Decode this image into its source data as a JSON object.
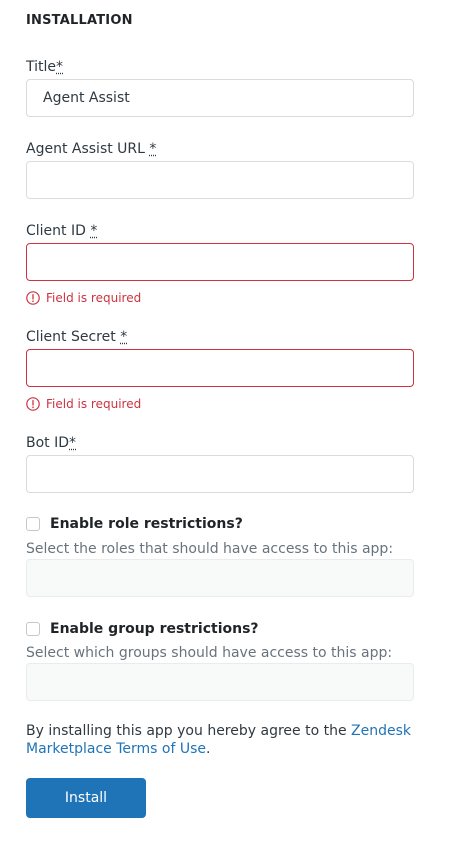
{
  "section": {
    "heading": "INSTALLATION"
  },
  "form": {
    "title": {
      "label": "Title",
      "required_mark": "*",
      "value": "Agent Assist",
      "placeholder": ""
    },
    "agent_assist_url": {
      "label": "Agent Assist URL ",
      "required_mark": "*",
      "value": "",
      "placeholder": ""
    },
    "client_id": {
      "label": "Client ID ",
      "required_mark": "*",
      "value": "",
      "placeholder": "",
      "error": "Field is required"
    },
    "client_secret": {
      "label": "Client Secret ",
      "required_mark": "*",
      "value": "",
      "placeholder": "",
      "error": "Field is required"
    },
    "bot_id": {
      "label": "Bot ID",
      "required_mark": "*",
      "value": "",
      "placeholder": ""
    }
  },
  "restrictions": {
    "role": {
      "label": "Enable role restrictions?",
      "hint": "Select the roles that should have access to this app:",
      "checked": false
    },
    "group": {
      "label": "Enable group restrictions?",
      "hint": "Select which groups should have access to this app:",
      "checked": false
    }
  },
  "terms": {
    "prefix": "By installing this app you hereby agree to the ",
    "link_text": "Zendesk Marketplace Terms of Use",
    "suffix": "."
  },
  "actions": {
    "install_label": "Install"
  },
  "colors": {
    "primary": "#1f73b7",
    "error": "#cc3340",
    "border": "#d8dcde",
    "disabled_bg": "#f8f9f9"
  },
  "icons": {
    "error": "alert-circle-icon"
  }
}
